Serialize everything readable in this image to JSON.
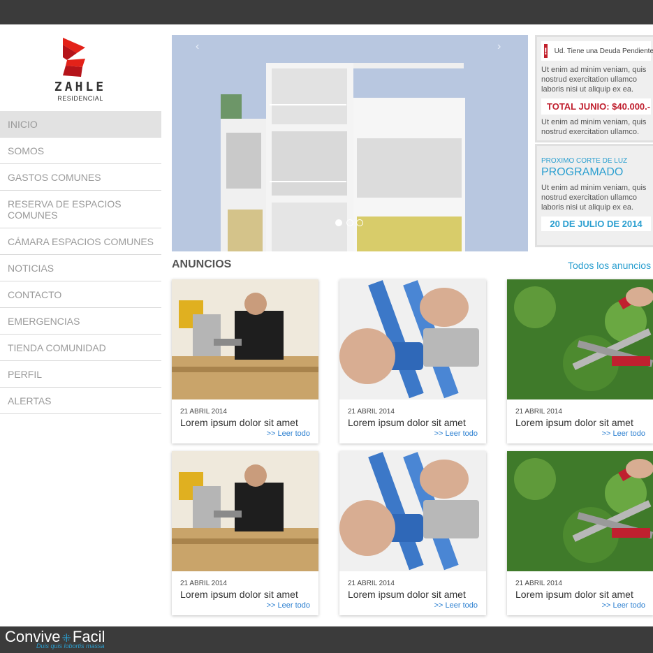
{
  "colors": {
    "topbar": "#3b3b3b",
    "accent": "#2b9fd0",
    "alert": "#c0202f",
    "brand_red": "#e32219"
  },
  "logo": {
    "wordmark": "ZAHLE",
    "subtitle": "RESIDENCIAL"
  },
  "nav": {
    "items": [
      {
        "label": "INICIO",
        "active": true
      },
      {
        "label": "SOMOS"
      },
      {
        "label": "GASTOS COMUNES"
      },
      {
        "label": "RESERVA DE ESPACIOS COMUNES"
      },
      {
        "label": "CÁMARA ESPACIOS COMUNES"
      },
      {
        "label": "NOTICIAS"
      },
      {
        "label": "CONTACTO"
      },
      {
        "label": "EMERGENCIAS"
      },
      {
        "label": "TIENDA COMUNIDAD"
      },
      {
        "label": "PERFIL"
      },
      {
        "label": "ALERTAS"
      }
    ]
  },
  "slider": {
    "prev": "‹",
    "next": "›",
    "slide_count": 3,
    "active_index": 0
  },
  "debt_box": {
    "icon": "!",
    "title": "Ud. Tiene una Deuda Pendiente",
    "text1": "Ut enim ad minim veniam, quis nostrud exercitation ullamco laboris nisi ut aliquip ex ea.",
    "amount": "TOTAL JUNIO: $40.000.-",
    "text2": "Ut enim ad minim veniam, quis nostrud exercitation ullamco."
  },
  "power_box": {
    "label": "PROXIMO CORTE DE LUZ",
    "title": "PROGRAMADO",
    "text": "Ut enim ad minim veniam, quis nostrud exercitation ullamco laboris nisi ut aliquip ex ea.",
    "date": "20 DE JULIO DE 2014"
  },
  "announcements": {
    "heading": "ANUNCIOS",
    "all_link": "Todos los anuncios",
    "cards": [
      {
        "image": "carpenter-photo",
        "date": "21 ABRIL 2014",
        "title": "Lorem ipsum dolor sit amet",
        "more": ">> Leer todo"
      },
      {
        "image": "pipes-photo",
        "date": "21 ABRIL 2014",
        "title": "Lorem ipsum dolor sit amet",
        "more": ">> Leer todo"
      },
      {
        "image": "hedge-shears-photo",
        "date": "21 ABRIL 2014",
        "title": "Lorem ipsum dolor sit amet",
        "more": ">> Leer todo"
      },
      {
        "image": "carpenter-photo",
        "date": "21 ABRIL 2014",
        "title": "Lorem ipsum dolor sit amet",
        "more": ">> Leer todo"
      },
      {
        "image": "pipes-photo",
        "date": "21 ABRIL 2014",
        "title": "Lorem ipsum dolor sit amet",
        "more": ">> Leer todo"
      },
      {
        "image": "hedge-shears-photo",
        "date": "21 ABRIL 2014",
        "title": "Lorem ipsum dolor sit amet",
        "more": ">> Leer todo"
      }
    ]
  },
  "footer": {
    "brand_left": "Convive",
    "brand_mark": "⁜",
    "brand_right": "Facil",
    "tagline": "Duis quis lobortis massa"
  }
}
